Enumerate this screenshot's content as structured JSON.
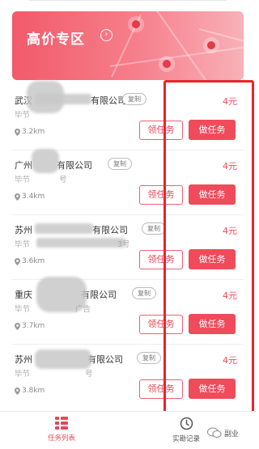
{
  "banner": {
    "title": "高价专区",
    "chevron": "›"
  },
  "colors": {
    "accent": "#f04b5a",
    "highlight": "#e8242b"
  },
  "tasks": [
    {
      "company": "武汉",
      "company_suffix": "有限公司",
      "copy_label": "复制",
      "address": "毕节",
      "distance": "3.2km",
      "price": "4元",
      "claim_label": "领任务",
      "do_label": "做任务"
    },
    {
      "company": "广州",
      "company_suffix": "有限公司",
      "copy_label": "复制",
      "address": "毕节",
      "address_suffix": "号",
      "distance": "3.4km",
      "price": "4元",
      "claim_label": "领任务",
      "do_label": "做任务"
    },
    {
      "company": "苏州",
      "company_suffix": "有限公司",
      "copy_label": "复制",
      "address": "毕节",
      "address_suffix": "3号",
      "distance": "3.6km",
      "price": "4元",
      "claim_label": "领任务",
      "do_label": "做任务"
    },
    {
      "company": "重庆",
      "company_suffix": "有限公司",
      "copy_label": "复制",
      "address": "毕节",
      "address_suffix": "广告",
      "distance": "3.7km",
      "price": "4元",
      "claim_label": "领任务",
      "do_label": "做任务"
    },
    {
      "company": "苏州",
      "company_suffix": "有限公司",
      "copy_label": "复制",
      "address": "毕节",
      "address_suffix": "号",
      "distance": "3.8km",
      "price": "4元",
      "claim_label": "领任务",
      "do_label": "做任务"
    }
  ],
  "tabbar": {
    "tasks_label": "任务列表",
    "records_label": "实勘记录"
  },
  "watermark": {
    "text": "副业"
  }
}
